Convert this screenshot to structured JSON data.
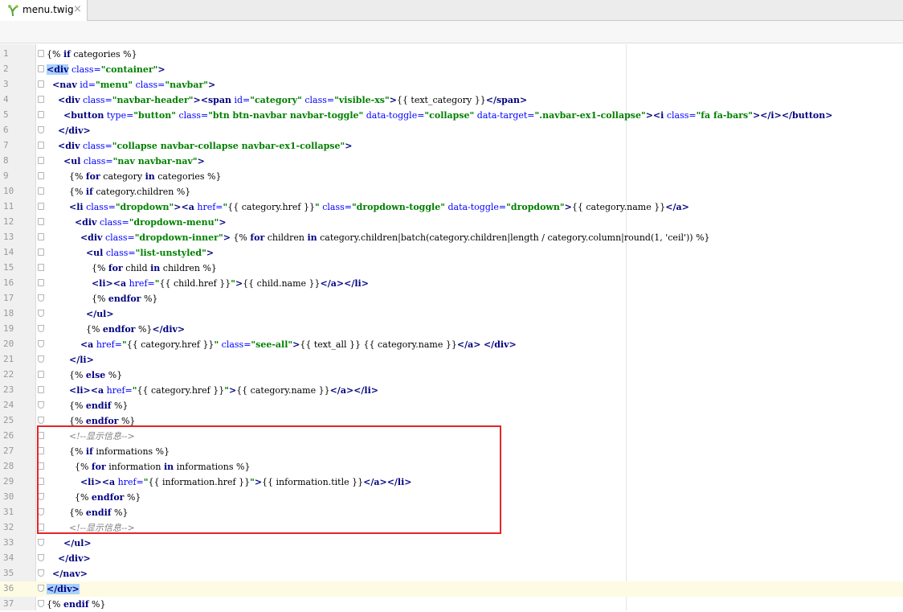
{
  "tab": {
    "title": "menu.twig",
    "close": "×",
    "icon": "twig-icon"
  },
  "editor": {
    "current_line": 36,
    "lines": [
      {
        "n": "1",
        "html": "{% <span class=\"kw\">if</span> categories %}"
      },
      {
        "n": "2",
        "html": "<span class=\"hl\"><span class=\"tag\">&lt;div</span></span> <span class=\"attr\">class=</span><span class=\"str\">\"container\"</span><span class=\"tag\">&gt;</span>"
      },
      {
        "n": "3",
        "html": "  <span class=\"tag\">&lt;nav</span> <span class=\"attr\">id=</span><span class=\"str\">\"menu\"</span> <span class=\"attr\">class=</span><span class=\"str\">\"navbar\"</span><span class=\"tag\">&gt;</span>"
      },
      {
        "n": "4",
        "html": "    <span class=\"tag\">&lt;div</span> <span class=\"attr\">class=</span><span class=\"str\">\"navbar-header\"</span><span class=\"tag\">&gt;&lt;span</span> <span class=\"attr\">id=</span><span class=\"str\">\"category\"</span> <span class=\"attr\">class=</span><span class=\"str\">\"visible-xs\"</span><span class=\"tag\">&gt;</span>{{ text_category }}<span class=\"tag\">&lt;/span&gt;</span>"
      },
      {
        "n": "5",
        "html": "      <span class=\"tag\">&lt;button</span> <span class=\"attr\">type=</span><span class=\"str\">\"button\"</span> <span class=\"attr\">class=</span><span class=\"str\">\"btn btn-navbar navbar-toggle\"</span> <span class=\"attr\">data-toggle=</span><span class=\"str\">\"collapse\"</span> <span class=\"attr\">data-target=</span><span class=\"str\">\".navbar-ex1-collapse\"</span><span class=\"tag\">&gt;&lt;i</span> <span class=\"attr\">class=</span><span class=\"str\">\"fa fa-bars\"</span><span class=\"tag\">&gt;&lt;/i&gt;&lt;/button&gt;</span>"
      },
      {
        "n": "6",
        "html": "    <span class=\"tag\">&lt;/div&gt;</span>"
      },
      {
        "n": "7",
        "html": "    <span class=\"tag\">&lt;div</span> <span class=\"attr\">class=</span><span class=\"str\">\"collapse navbar-collapse navbar-ex1-collapse\"</span><span class=\"tag\">&gt;</span>"
      },
      {
        "n": "8",
        "html": "      <span class=\"tag\">&lt;ul</span> <span class=\"attr\">class=</span><span class=\"str\">\"nav navbar-nav\"</span><span class=\"tag\">&gt;</span>"
      },
      {
        "n": "9",
        "html": "        {% <span class=\"kw\">for</span> category <span class=\"kw\">in</span> categories %}"
      },
      {
        "n": "10",
        "html": "        {% <span class=\"kw\">if</span> category.children %}"
      },
      {
        "n": "11",
        "html": "        <span class=\"tag\">&lt;li</span> <span class=\"attr\">class=</span><span class=\"str\">\"dropdown\"</span><span class=\"tag\">&gt;&lt;a</span> <span class=\"attr\">href=</span><span class=\"str\">\"</span>{{ category.href }}<span class=\"str\">\"</span> <span class=\"attr\">class=</span><span class=\"str\">\"dropdown-toggle\"</span> <span class=\"attr\">data-toggle=</span><span class=\"str\">\"dropdown\"</span><span class=\"tag\">&gt;</span>{{ category.name }}<span class=\"tag\">&lt;/a&gt;</span>"
      },
      {
        "n": "12",
        "html": "          <span class=\"tag\">&lt;div</span> <span class=\"attr\">class=</span><span class=\"str\">\"dropdown-menu\"</span><span class=\"tag\">&gt;</span>"
      },
      {
        "n": "13",
        "html": "            <span class=\"tag\">&lt;div</span> <span class=\"attr\">class=</span><span class=\"str\">\"dropdown-inner\"</span><span class=\"tag\">&gt;</span> {% <span class=\"kw\">for</span> children <span class=\"kw\">in</span> category.children|batch(category.children|length / category.column|round(1, 'ceil')) %}"
      },
      {
        "n": "14",
        "html": "              <span class=\"tag\">&lt;ul</span> <span class=\"attr\">class=</span><span class=\"str\">\"list-unstyled\"</span><span class=\"tag\">&gt;</span>"
      },
      {
        "n": "15",
        "html": "                {% <span class=\"kw\">for</span> child <span class=\"kw\">in</span> children %}"
      },
      {
        "n": "16",
        "html": "                <span class=\"tag\">&lt;li&gt;&lt;a</span> <span class=\"attr\">href=</span><span class=\"str\">\"</span>{{ child.href }}<span class=\"str\">\"</span><span class=\"tag\">&gt;</span>{{ child.name }}<span class=\"tag\">&lt;/a&gt;&lt;/li&gt;</span>"
      },
      {
        "n": "17",
        "html": "                {% <span class=\"kw\">endfor</span> %}"
      },
      {
        "n": "18",
        "html": "              <span class=\"tag\">&lt;/ul&gt;</span>"
      },
      {
        "n": "19",
        "html": "              {% <span class=\"kw\">endfor</span> %}<span class=\"tag\">&lt;/div&gt;</span>"
      },
      {
        "n": "20",
        "html": "            <span class=\"tag\">&lt;a</span> <span class=\"attr\">href=</span><span class=\"str\">\"</span>{{ category.href }}<span class=\"str\">\"</span> <span class=\"attr\">class=</span><span class=\"str\">\"see-all\"</span><span class=\"tag\">&gt;</span>{{ text_all }} {{ category.name }}<span class=\"tag\">&lt;/a&gt;</span> <span class=\"tag\">&lt;/div&gt;</span>"
      },
      {
        "n": "21",
        "html": "        <span class=\"tag\">&lt;/li&gt;</span>"
      },
      {
        "n": "22",
        "html": "        {% <span class=\"kw\">else</span> %}"
      },
      {
        "n": "23",
        "html": "        <span class=\"tag\">&lt;li&gt;&lt;a</span> <span class=\"attr\">href=</span><span class=\"str\">\"</span>{{ category.href }}<span class=\"str\">\"</span><span class=\"tag\">&gt;</span>{{ category.name }}<span class=\"tag\">&lt;/a&gt;&lt;/li&gt;</span>"
      },
      {
        "n": "24",
        "html": "        {% <span class=\"kw\">endif</span> %}"
      },
      {
        "n": "25",
        "html": "        {% <span class=\"kw\">endfor</span> %}"
      },
      {
        "n": "26",
        "html": "        <span class=\"cmt\">&lt;!--显示信息--&gt;</span>"
      },
      {
        "n": "27",
        "html": "        {% <span class=\"kw\">if</span> informations %}"
      },
      {
        "n": "28",
        "html": "          {% <span class=\"kw\">for</span> information <span class=\"kw\">in</span> informations %}"
      },
      {
        "n": "29",
        "html": "            <span class=\"tag\">&lt;li&gt;&lt;a</span> <span class=\"attr\">href=</span><span class=\"str\">\"</span>{{ information.href }}<span class=\"str\">\"</span><span class=\"tag\">&gt;</span>{{ information.title }}<span class=\"tag\">&lt;/a&gt;&lt;/li&gt;</span>"
      },
      {
        "n": "30",
        "html": "          {% <span class=\"kw\">endfor</span> %}"
      },
      {
        "n": "31",
        "html": "        {% <span class=\"kw\">endif</span> %}"
      },
      {
        "n": "32",
        "html": "        <span class=\"cmt\">&lt;!--显示信息--&gt;</span>"
      },
      {
        "n": "33",
        "html": "      <span class=\"tag\">&lt;/ul&gt;</span>"
      },
      {
        "n": "34",
        "html": "    <span class=\"tag\">&lt;/div&gt;</span>"
      },
      {
        "n": "35",
        "html": "  <span class=\"tag\">&lt;/nav&gt;</span>"
      },
      {
        "n": "36",
        "html": "<span class=\"hl\"><span class=\"tag\">&lt;/div&gt;</span></span>"
      },
      {
        "n": "37",
        "html": "{% <span class=\"kw\">endif</span> %}"
      }
    ]
  }
}
